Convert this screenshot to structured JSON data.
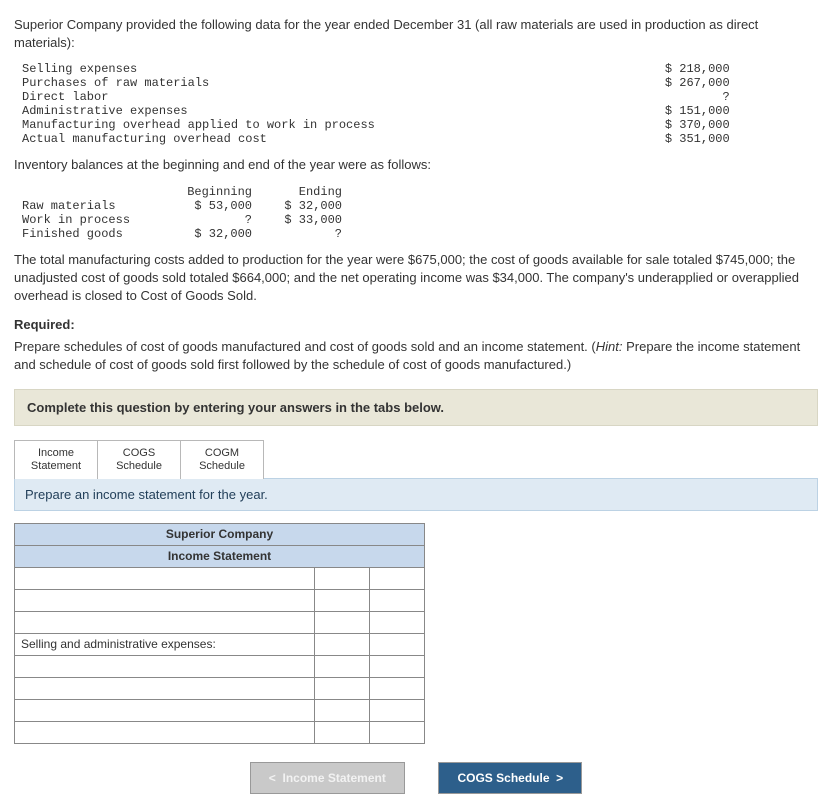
{
  "intro": "Superior Company provided the following data for the year ended December 31 (all raw materials are used in production as direct materials):",
  "lines": [
    {
      "label": "Selling expenses",
      "value": "$ 218,000"
    },
    {
      "label": "Purchases of raw materials",
      "value": "$ 267,000"
    },
    {
      "label": "Direct labor",
      "value": "?"
    },
    {
      "label": "Administrative expenses",
      "value": "$ 151,000"
    },
    {
      "label": "Manufacturing overhead applied to work in process",
      "value": "$ 370,000"
    },
    {
      "label": "Actual manufacturing overhead cost",
      "value": "$ 351,000"
    }
  ],
  "inv_intro": "Inventory balances at the beginning and end of the year were as follows:",
  "inv_headers": {
    "c1": "",
    "c2": "Beginning",
    "c3": "Ending"
  },
  "inv_rows": [
    {
      "label": "Raw materials",
      "beg": "$ 53,000",
      "end": "$ 32,000"
    },
    {
      "label": "Work in process",
      "beg": "?",
      "end": "$ 33,000"
    },
    {
      "label": "Finished goods",
      "beg": "$ 32,000",
      "end": "?"
    }
  ],
  "narrative": "The total manufacturing costs added to production for the year were $675,000; the cost of goods available for sale totaled $745,000; the unadjusted cost of goods sold totaled $664,000; and the net operating income was $34,000. The company's underapplied or overapplied overhead is closed to Cost of Goods Sold.",
  "required_label": "Required:",
  "required_body_pre": "Prepare schedules of cost of goods manufactured and cost of goods sold and an income statement. (",
  "required_hint_label": "Hint:",
  "required_body_post": " Prepare the income statement and schedule of cost of goods sold first followed by the schedule of cost of goods manufactured.)",
  "prompt_bar": "Complete this question by entering your answers in the tabs below.",
  "tabs": {
    "t1a": "Income",
    "t1b": "Statement",
    "t2a": "COGS",
    "t2b": "Schedule",
    "t3a": "COGM",
    "t3b": "Schedule"
  },
  "sub_instr": "Prepare an income statement for the year.",
  "ws_title": "Superior Company",
  "ws_sub": "Income Statement",
  "ws_row_label": "Selling and administrative expenses:",
  "nav_prev_icon": "<",
  "nav_prev": "Income Statement",
  "nav_next": "COGS Schedule",
  "nav_next_icon": ">"
}
